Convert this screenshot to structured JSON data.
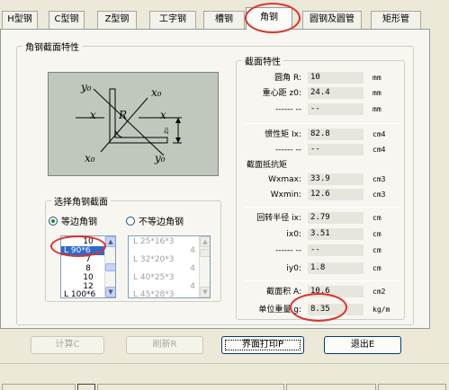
{
  "tabs": [
    "H型钢",
    "C型钢",
    "Z型钢",
    "工字钢",
    "槽钢",
    "角钢",
    "圆钢及圆管",
    "矩形管"
  ],
  "active_tab": "角钢",
  "section_group_title": "角钢截面特性",
  "diagram_labels": {
    "y0_top": "y₀",
    "x0_top": "x₀",
    "x_left": "x",
    "R": "R",
    "x_right": "x",
    "x0_bottom": "x₀",
    "y0_bottom": "y₀",
    "z0": "z₀"
  },
  "select_group_title": "选择角钢截面",
  "radio_equal": "等边角钢",
  "radio_unequal": "不等边角钢",
  "equal_list": [
    "10",
    "L 90*6",
    "7",
    "8",
    "10",
    "12",
    "L 100*6"
  ],
  "equal_list_selected": "L 90*6",
  "unequal_list": [
    "L 25*16*3",
    "4",
    "L 32*20*3",
    "4",
    "L 40*25*3",
    "4",
    "L 45*28*3"
  ],
  "props_title": "截面特性",
  "props": {
    "r_label": "圆角    R:",
    "r_value": "10",
    "r_unit": "mm",
    "z0_label": "重心距  z0:",
    "z0_value": "24.4",
    "z0_unit": "mm",
    "blank1_label": "------  --",
    "blank1_value": "--",
    "blank1_unit": "mm",
    "ix_label": "惯性矩  Ix:",
    "ix_value": "82.8",
    "ix_unit": "cm4",
    "blank2_label": "------  --",
    "blank2_value": "--",
    "blank2_unit": "cm4",
    "modulus_head": "截面抵抗矩",
    "wxmax_label": "Wxmax:",
    "wxmax_value": "33.9",
    "wxmax_unit": "cm3",
    "wxmin_label": "Wxmin:",
    "wxmin_value": "12.6",
    "wxmin_unit": "cm3",
    "ix_r_label": "回转半径  ix:",
    "ix_r_value": "2.79",
    "ix_r_unit": "cm",
    "ix0_label": "ix0:",
    "ix0_value": "3.51",
    "ix0_unit": "cm",
    "blank3_label": "------  --",
    "blank3_value": "--",
    "blank3_unit": "cm",
    "iy0_label": "iy0:",
    "iy0_value": "1.8",
    "iy0_unit": "cm",
    "area_label": "截面积  A:",
    "area_value": "10.6",
    "area_unit": "cm2",
    "weight_label": "单位重量  g:",
    "weight_value": "8.35",
    "weight_unit": "kg/m"
  },
  "buttons": {
    "calc": "计算C",
    "refresh": "刷新R",
    "print": "界面打印P",
    "exit": "退出E"
  },
  "colors": {
    "accent_circle": "#e0302a",
    "selection": "#316ac5",
    "diagram_bg": "#c0c7bd"
  }
}
